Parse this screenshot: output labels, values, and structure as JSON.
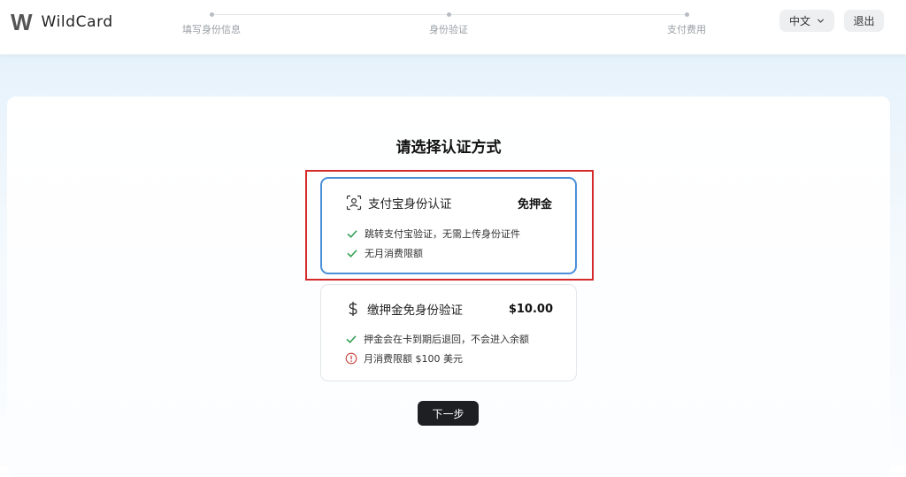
{
  "app": {
    "name": "WildCard",
    "logo_mark": "W"
  },
  "steps": [
    {
      "label": "填写身份信息"
    },
    {
      "label": "身份验证"
    },
    {
      "label": "支付费用"
    }
  ],
  "header": {
    "language_label": "中文",
    "logout_label": "退出"
  },
  "main": {
    "title": "请选择认证方式",
    "options": [
      {
        "title": "支付宝身份认证",
        "price": "免押金",
        "icon": "face-scan-icon",
        "selected": true,
        "features": [
          {
            "icon": "check-icon",
            "text": "跳转支付宝验证，无需上传身份证件"
          },
          {
            "icon": "check-icon",
            "text": "无月消费限额"
          }
        ]
      },
      {
        "title": "缴押金免身份验证",
        "price": "$10.00",
        "icon": "dollar-icon",
        "selected": false,
        "features": [
          {
            "icon": "check-icon",
            "text": "押金会在卡到期后退回，不会进入余额"
          },
          {
            "icon": "info-icon",
            "text": "月消费限额 $100 美元"
          }
        ]
      }
    ],
    "next_label": "下一步"
  },
  "colors": {
    "accent_blue": "#4a90d9",
    "highlight_red": "#d42a2a",
    "check_green": "#2e9d4e",
    "warning_red": "#c9453b",
    "button_dark": "#1d1f22"
  }
}
